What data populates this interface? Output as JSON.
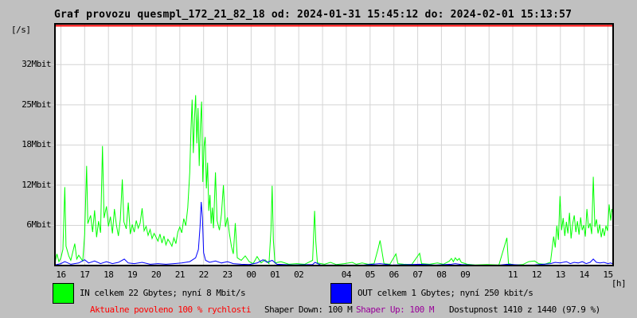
{
  "title": "Graf provozu quesmpl_172_21_82_18 od: 2024-01-31 15:45:12 do: 2024-02-01 15:13:57",
  "colors": {
    "background": "#c0c0c0",
    "plot_background": "#ffffff",
    "grid": "#d4d4d4",
    "frame": "#000000",
    "in_line": "#00ff00",
    "out_line": "#0000ff",
    "limit_line": "#ff0000",
    "allowed_text": "#ff0000",
    "shaper_up_text": "#990099",
    "text": "#000000"
  },
  "legend": {
    "in_label": "IN celkem 22 Gbytes; nyní 8 Mbit/s",
    "out_label": "OUT celkem 1 Gbytes; nyní 250 kbit/s"
  },
  "status": {
    "allowed": "Aktualne povoleno 100 % rychlosti",
    "shaper_down": "Shaper Down: 100 M",
    "shaper_up": "Shaper Up: 100 M",
    "availability": "Dostupnost 1410 z 1440 (97.9 %)"
  },
  "chart_data": {
    "type": "line",
    "title": "Graf provozu quesmpl_172_21_82_18 od: 2024-01-31 15:45:12 do: 2024-02-01 15:13:57",
    "xlabel": "[h]",
    "ylabel": "[/s]",
    "grid": true,
    "legend_position": "bottom",
    "x_unit": "minutes since 2024-01-31 15:45",
    "y_unit": "Mbit/s",
    "x_range_minutes": [
      0,
      1408
    ],
    "y_max": 37.6,
    "limit_line": {
      "value": 37.3,
      "color": "#ff0000"
    },
    "y_ticks": [
      {
        "label": "6Mbit",
        "value": 6.25
      },
      {
        "label": "12Mbit",
        "value": 12.5
      },
      {
        "label": "18Mbit",
        "value": 18.75
      },
      {
        "label": "25Mbit",
        "value": 25
      },
      {
        "label": "32Mbit",
        "value": 31.25
      }
    ],
    "x_ticks": [
      {
        "label": "16",
        "minute": 15
      },
      {
        "label": "17",
        "minute": 75
      },
      {
        "label": "18",
        "minute": 135
      },
      {
        "label": "19",
        "minute": 195
      },
      {
        "label": "20",
        "minute": 255
      },
      {
        "label": "21",
        "minute": 315
      },
      {
        "label": "22",
        "minute": 375
      },
      {
        "label": "23",
        "minute": 435
      },
      {
        "label": "00",
        "minute": 495
      },
      {
        "label": "01",
        "minute": 555
      },
      {
        "label": "02",
        "minute": 615
      },
      {
        "label": "",
        "minute": 675
      },
      {
        "label": "04",
        "minute": 735
      },
      {
        "label": "05",
        "minute": 795
      },
      {
        "label": "06",
        "minute": 855
      },
      {
        "label": "07",
        "minute": 915
      },
      {
        "label": "08",
        "minute": 975
      },
      {
        "label": "09",
        "minute": 1035
      },
      {
        "label": "",
        "minute": 1095
      },
      {
        "label": "11",
        "minute": 1155
      },
      {
        "label": "12",
        "minute": 1215
      },
      {
        "label": "13",
        "minute": 1275
      },
      {
        "label": "14",
        "minute": 1335
      },
      {
        "label": "15",
        "minute": 1395
      }
    ],
    "series": [
      {
        "name": "IN",
        "color": "#00ff00",
        "total": "22 Gbytes",
        "current": "8 Mbit/s",
        "points": [
          [
            0,
            0.4
          ],
          [
            5,
            1.8
          ],
          [
            10,
            0.6
          ],
          [
            15,
            1.2
          ],
          [
            20,
            2.5
          ],
          [
            25,
            12.2
          ],
          [
            28,
            3.0
          ],
          [
            35,
            1.5
          ],
          [
            40,
            0.8
          ],
          [
            50,
            3.4
          ],
          [
            55,
            1.0
          ],
          [
            60,
            1.6
          ],
          [
            70,
            0.7
          ],
          [
            75,
            4.8
          ],
          [
            80,
            15.5
          ],
          [
            83,
            6.5
          ],
          [
            90,
            7.8
          ],
          [
            95,
            5.2
          ],
          [
            100,
            8.6
          ],
          [
            105,
            4.4
          ],
          [
            110,
            6.9
          ],
          [
            115,
            5.1
          ],
          [
            120,
            18.6
          ],
          [
            124,
            7.4
          ],
          [
            130,
            9.2
          ],
          [
            135,
            6.1
          ],
          [
            140,
            7.6
          ],
          [
            145,
            5.0
          ],
          [
            150,
            8.8
          ],
          [
            155,
            6.3
          ],
          [
            160,
            4.6
          ],
          [
            165,
            7.2
          ],
          [
            170,
            13.4
          ],
          [
            174,
            6.8
          ],
          [
            180,
            5.7
          ],
          [
            185,
            9.8
          ],
          [
            190,
            4.9
          ],
          [
            195,
            6.4
          ],
          [
            200,
            5.2
          ],
          [
            205,
            7.0
          ],
          [
            210,
            5.8
          ],
          [
            215,
            6.6
          ],
          [
            220,
            8.9
          ],
          [
            225,
            5.4
          ],
          [
            230,
            6.1
          ],
          [
            235,
            4.7
          ],
          [
            240,
            5.6
          ],
          [
            245,
            4.2
          ],
          [
            250,
            5.0
          ],
          [
            255,
            4.4
          ],
          [
            260,
            3.8
          ],
          [
            265,
            4.9
          ],
          [
            270,
            3.5
          ],
          [
            275,
            4.6
          ],
          [
            280,
            3.2
          ],
          [
            285,
            4.1
          ],
          [
            290,
            3.6
          ],
          [
            295,
            3.0
          ],
          [
            300,
            4.3
          ],
          [
            305,
            3.4
          ],
          [
            310,
            5.2
          ],
          [
            315,
            6.0
          ],
          [
            320,
            5.1
          ],
          [
            325,
            7.3
          ],
          [
            330,
            6.2
          ],
          [
            335,
            9.0
          ],
          [
            340,
            14.5
          ],
          [
            343,
            21.0
          ],
          [
            346,
            25.8
          ],
          [
            349,
            17.5
          ],
          [
            352,
            23.0
          ],
          [
            355,
            26.5
          ],
          [
            358,
            19.0
          ],
          [
            361,
            24.5
          ],
          [
            364,
            15.5
          ],
          [
            367,
            22.0
          ],
          [
            370,
            25.5
          ],
          [
            373,
            13.0
          ],
          [
            376,
            18.5
          ],
          [
            379,
            20.0
          ],
          [
            382,
            12.0
          ],
          [
            385,
            16.0
          ],
          [
            388,
            8.5
          ],
          [
            391,
            11.0
          ],
          [
            394,
            6.5
          ],
          [
            397,
            9.0
          ],
          [
            400,
            5.8
          ],
          [
            405,
            14.5
          ],
          [
            409,
            7.0
          ],
          [
            415,
            5.5
          ],
          [
            420,
            8.0
          ],
          [
            425,
            12.5
          ],
          [
            430,
            6.0
          ],
          [
            435,
            7.5
          ],
          [
            440,
            5.0
          ],
          [
            445,
            3.0
          ],
          [
            450,
            1.8
          ],
          [
            455,
            6.6
          ],
          [
            460,
            1.2
          ],
          [
            470,
            0.8
          ],
          [
            480,
            1.5
          ],
          [
            490,
            0.6
          ],
          [
            500,
            0.3
          ],
          [
            510,
            1.4
          ],
          [
            520,
            0.4
          ],
          [
            530,
            0.9
          ],
          [
            540,
            0.3
          ],
          [
            545,
            5.5
          ],
          [
            548,
            12.4
          ],
          [
            551,
            4.0
          ],
          [
            555,
            0.4
          ],
          [
            570,
            0.6
          ],
          [
            590,
            0.2
          ],
          [
            610,
            0.3
          ],
          [
            630,
            0.2
          ],
          [
            650,
            0.8
          ],
          [
            655,
            8.5
          ],
          [
            658,
            3.8
          ],
          [
            662,
            0.4
          ],
          [
            680,
            0.2
          ],
          [
            695,
            0.5
          ],
          [
            710,
            0.15
          ],
          [
            730,
            0.3
          ],
          [
            750,
            0.5
          ],
          [
            760,
            0.2
          ],
          [
            775,
            0.4
          ],
          [
            790,
            0.2
          ],
          [
            805,
            0.3
          ],
          [
            815,
            2.6
          ],
          [
            820,
            3.9
          ],
          [
            825,
            2.2
          ],
          [
            830,
            0.3
          ],
          [
            845,
            0.2
          ],
          [
            860,
            1.8
          ],
          [
            865,
            0.3
          ],
          [
            880,
            0.2
          ],
          [
            900,
            0.15
          ],
          [
            920,
            1.9
          ],
          [
            925,
            0.3
          ],
          [
            945,
            0.2
          ],
          [
            965,
            0.4
          ],
          [
            980,
            0.2
          ],
          [
            995,
            0.7
          ],
          [
            1000,
            1.1
          ],
          [
            1005,
            0.6
          ],
          [
            1010,
            1.2
          ],
          [
            1015,
            0.8
          ],
          [
            1020,
            1.1
          ],
          [
            1025,
            0.5
          ],
          [
            1040,
            0.2
          ],
          [
            1060,
            0.1
          ],
          [
            1090,
            0.15
          ],
          [
            1120,
            0.1
          ],
          [
            1140,
            4.3
          ],
          [
            1144,
            0.3
          ],
          [
            1160,
            0.1
          ],
          [
            1180,
            0.15
          ],
          [
            1195,
            0.6
          ],
          [
            1210,
            0.7
          ],
          [
            1220,
            0.3
          ],
          [
            1235,
            0.2
          ],
          [
            1250,
            0.5
          ],
          [
            1258,
            4.5
          ],
          [
            1262,
            2.8
          ],
          [
            1266,
            6.2
          ],
          [
            1270,
            4.0
          ],
          [
            1274,
            10.8
          ],
          [
            1278,
            5.5
          ],
          [
            1282,
            7.4
          ],
          [
            1286,
            4.6
          ],
          [
            1290,
            6.8
          ],
          [
            1294,
            5.0
          ],
          [
            1298,
            8.2
          ],
          [
            1302,
            4.2
          ],
          [
            1306,
            6.5
          ],
          [
            1310,
            7.8
          ],
          [
            1314,
            5.2
          ],
          [
            1318,
            6.9
          ],
          [
            1322,
            4.8
          ],
          [
            1326,
            7.5
          ],
          [
            1330,
            5.5
          ],
          [
            1334,
            6.3
          ],
          [
            1338,
            4.5
          ],
          [
            1342,
            8.8
          ],
          [
            1346,
            5.8
          ],
          [
            1350,
            6.6
          ],
          [
            1354,
            4.9
          ],
          [
            1358,
            13.8
          ],
          [
            1362,
            6.0
          ],
          [
            1366,
            7.2
          ],
          [
            1370,
            5.0
          ],
          [
            1374,
            6.4
          ],
          [
            1378,
            4.4
          ],
          [
            1382,
            5.8
          ],
          [
            1386,
            4.6
          ],
          [
            1390,
            6.2
          ],
          [
            1394,
            5.4
          ],
          [
            1398,
            9.5
          ],
          [
            1402,
            7.0
          ],
          [
            1405,
            8.8
          ],
          [
            1408,
            8.0
          ]
        ]
      },
      {
        "name": "OUT",
        "color": "#0000ff",
        "total": "1 Gbytes",
        "current": "250 kbit/s",
        "points": [
          [
            0,
            0.1
          ],
          [
            15,
            0.3
          ],
          [
            25,
            0.6
          ],
          [
            40,
            0.2
          ],
          [
            60,
            0.4
          ],
          [
            75,
            0.9
          ],
          [
            85,
            0.4
          ],
          [
            100,
            0.7
          ],
          [
            115,
            0.3
          ],
          [
            130,
            0.6
          ],
          [
            145,
            0.3
          ],
          [
            160,
            0.5
          ],
          [
            175,
            1.0
          ],
          [
            185,
            0.4
          ],
          [
            200,
            0.3
          ],
          [
            220,
            0.5
          ],
          [
            240,
            0.2
          ],
          [
            260,
            0.3
          ],
          [
            280,
            0.2
          ],
          [
            300,
            0.3
          ],
          [
            320,
            0.4
          ],
          [
            340,
            0.6
          ],
          [
            355,
            1.2
          ],
          [
            362,
            2.5
          ],
          [
            366,
            6.0
          ],
          [
            369,
            9.9
          ],
          [
            372,
            7.5
          ],
          [
            375,
            2.0
          ],
          [
            380,
            0.8
          ],
          [
            390,
            0.5
          ],
          [
            405,
            0.7
          ],
          [
            420,
            0.4
          ],
          [
            435,
            0.6
          ],
          [
            450,
            0.3
          ],
          [
            470,
            0.2
          ],
          [
            490,
            0.15
          ],
          [
            510,
            0.4
          ],
          [
            525,
            0.9
          ],
          [
            535,
            0.5
          ],
          [
            548,
            0.8
          ],
          [
            560,
            0.2
          ],
          [
            600,
            0.1
          ],
          [
            650,
            0.15
          ],
          [
            656,
            0.5
          ],
          [
            670,
            0.1
          ],
          [
            720,
            0.08
          ],
          [
            780,
            0.1
          ],
          [
            820,
            0.3
          ],
          [
            850,
            0.08
          ],
          [
            920,
            0.2
          ],
          [
            960,
            0.08
          ],
          [
            1000,
            0.2
          ],
          [
            1010,
            0.3
          ],
          [
            1025,
            0.15
          ],
          [
            1060,
            0.06
          ],
          [
            1120,
            0.06
          ],
          [
            1140,
            0.2
          ],
          [
            1180,
            0.06
          ],
          [
            1210,
            0.1
          ],
          [
            1250,
            0.3
          ],
          [
            1262,
            0.5
          ],
          [
            1274,
            0.4
          ],
          [
            1290,
            0.6
          ],
          [
            1300,
            0.3
          ],
          [
            1310,
            0.5
          ],
          [
            1320,
            0.4
          ],
          [
            1330,
            0.6
          ],
          [
            1340,
            0.3
          ],
          [
            1350,
            0.5
          ],
          [
            1358,
            1.0
          ],
          [
            1366,
            0.5
          ],
          [
            1375,
            0.4
          ],
          [
            1385,
            0.5
          ],
          [
            1395,
            0.3
          ],
          [
            1402,
            0.4
          ],
          [
            1408,
            0.25
          ]
        ]
      }
    ]
  }
}
